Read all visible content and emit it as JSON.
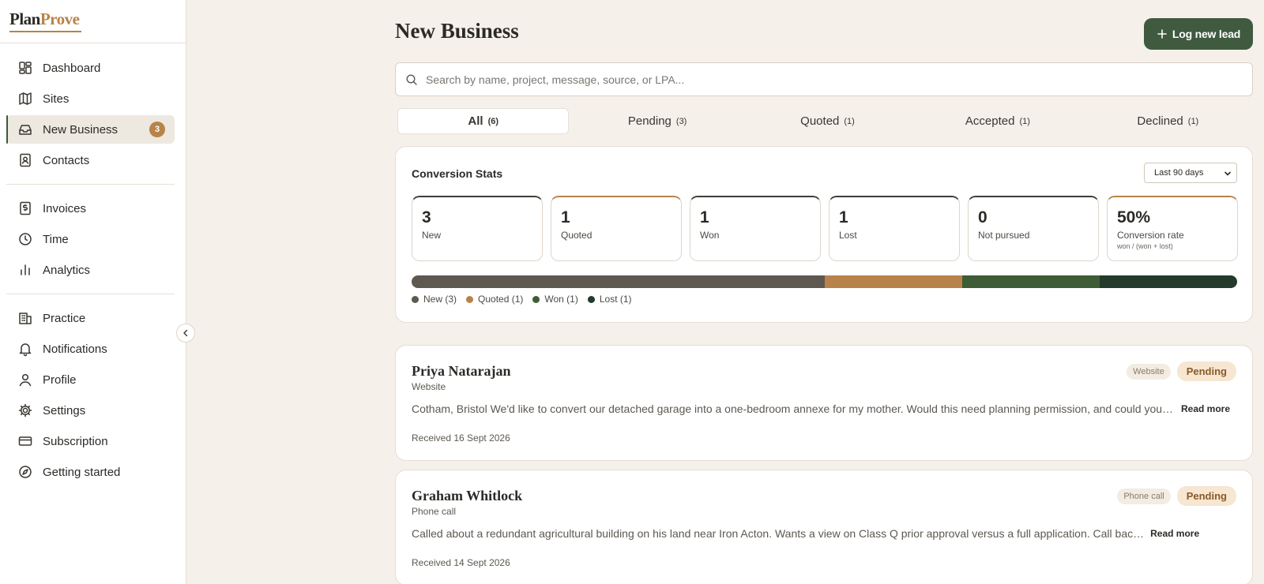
{
  "brand": {
    "plan": "Plan",
    "prove": "Prove"
  },
  "sidebar": {
    "groups": [
      [
        {
          "label": "Dashboard",
          "icon": "dashboard-icon"
        },
        {
          "label": "Sites",
          "icon": "map-icon"
        },
        {
          "label": "New Business",
          "icon": "inbox-icon",
          "badge": "3",
          "active": true
        },
        {
          "label": "Contacts",
          "icon": "contacts-icon"
        }
      ],
      [
        {
          "label": "Invoices",
          "icon": "invoice-icon"
        },
        {
          "label": "Time",
          "icon": "clock-icon"
        },
        {
          "label": "Analytics",
          "icon": "bar-chart-icon"
        }
      ],
      [
        {
          "label": "Practice",
          "icon": "building-icon"
        },
        {
          "label": "Notifications",
          "icon": "bell-icon"
        },
        {
          "label": "Profile",
          "icon": "user-icon"
        },
        {
          "label": "Settings",
          "icon": "gear-icon"
        },
        {
          "label": "Subscription",
          "icon": "card-icon"
        },
        {
          "label": "Getting started",
          "icon": "compass-icon"
        }
      ]
    ]
  },
  "header": {
    "title": "New Business",
    "log_button": "Log new lead"
  },
  "search": {
    "placeholder": "Search by name, project, message, source, or LPA..."
  },
  "tabs": [
    {
      "label": "All",
      "count": "(6)",
      "active": true
    },
    {
      "label": "Pending",
      "count": "(3)"
    },
    {
      "label": "Quoted",
      "count": "(1)"
    },
    {
      "label": "Accepted",
      "count": "(1)"
    },
    {
      "label": "Declined",
      "count": "(1)"
    }
  ],
  "stats": {
    "title": "Conversion Stats",
    "range": "Last 90 days",
    "cards": [
      {
        "value": "3",
        "label": "New",
        "accent": "dark"
      },
      {
        "value": "1",
        "label": "Quoted",
        "accent": "gold"
      },
      {
        "value": "1",
        "label": "Won",
        "accent": "dark"
      },
      {
        "value": "1",
        "label": "Lost",
        "accent": "dark"
      },
      {
        "value": "0",
        "label": "Not pursued",
        "accent": "dark"
      },
      {
        "value": "50%",
        "label": "Conversion rate",
        "sub": "won / (won + lost)",
        "accent": "gold"
      }
    ],
    "distribution": [
      {
        "label": "New (3)",
        "value": 3,
        "color": "#5e5850"
      },
      {
        "label": "Quoted (1)",
        "value": 1,
        "color": "#b8834a"
      },
      {
        "label": "Won (1)",
        "value": 1,
        "color": "#3e5c36"
      },
      {
        "label": "Lost (1)",
        "value": 1,
        "color": "#243a2a"
      }
    ]
  },
  "leads": [
    {
      "name": "Priya Natarajan",
      "source": "Website",
      "source_chip": "Website",
      "status": "Pending",
      "message": "Cotham, Bristol We'd like to convert our detached garage into a one-bedroom annexe for my mother. Would this need planning permission, and could you …",
      "read_more": "Read more",
      "received": "Received 16 Sept 2026"
    },
    {
      "name": "Graham Whitlock",
      "source": "Phone call",
      "source_chip": "Phone call",
      "status": "Pending",
      "message": "Called about a redundant agricultural building on his land near Iron Acton. Wants a view on Class Q prior approval versus a full application. Call bac…",
      "read_more": "Read more",
      "received": "Received 14 Sept 2026"
    }
  ]
}
